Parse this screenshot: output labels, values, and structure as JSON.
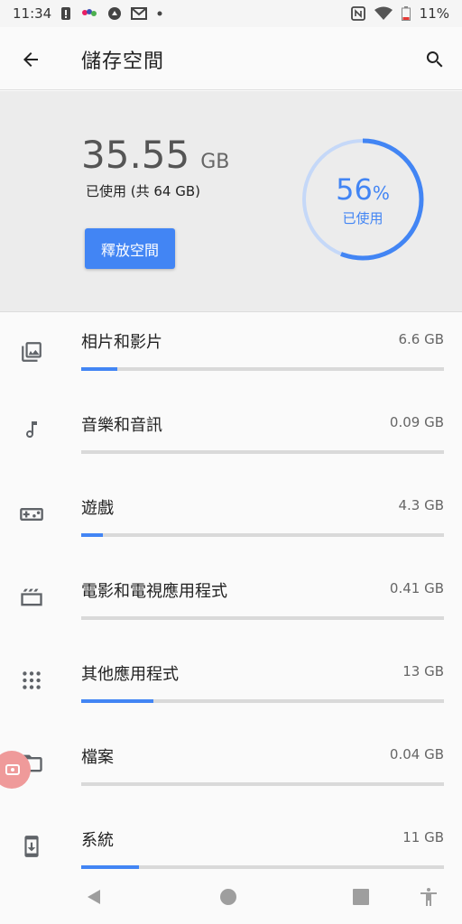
{
  "status_bar": {
    "time": "11:34",
    "battery": "11%",
    "icons": [
      "alert-icon",
      "app-icon",
      "circle-app-icon",
      "gmail-icon",
      "more-dots-icon",
      "nfc-icon",
      "wifi-icon",
      "battery-icon"
    ]
  },
  "app_bar": {
    "title": "儲存空間",
    "back_icon": "arrow-back-icon",
    "search_icon": "search-icon"
  },
  "summary": {
    "used_value": "35.55",
    "used_unit": "GB",
    "used_desc": "已使用 (共 64 GB)",
    "free_button": "釋放空間",
    "percent_value": "56",
    "percent_sign": "%",
    "percent_label": "已使用",
    "percent_fraction": 0.56,
    "accent_color": "#4285f4"
  },
  "categories": [
    {
      "name": "相片和影片",
      "size": "6.6 GB",
      "icon": "photo-icon",
      "fill_fraction": 0.1
    },
    {
      "name": "音樂和音訊",
      "size": "0.09 GB",
      "icon": "music-note-icon",
      "fill_fraction": 0.0
    },
    {
      "name": "遊戲",
      "size": "4.3 GB",
      "icon": "gamepad-icon",
      "fill_fraction": 0.06
    },
    {
      "name": "電影和電視應用程式",
      "size": "0.41 GB",
      "icon": "movie-icon",
      "fill_fraction": 0.0
    },
    {
      "name": "其他應用程式",
      "size": "13 GB",
      "icon": "apps-grid-icon",
      "fill_fraction": 0.2
    },
    {
      "name": "檔案",
      "size": "0.04 GB",
      "icon": "folder-icon",
      "fill_fraction": 0.0
    },
    {
      "name": "系統",
      "size": "11 GB",
      "icon": "system-update-icon",
      "fill_fraction": 0.16
    }
  ],
  "nav_bar": {
    "icons": [
      "nav-back-icon",
      "nav-home-icon",
      "nav-recents-icon",
      "accessibility-icon"
    ]
  }
}
